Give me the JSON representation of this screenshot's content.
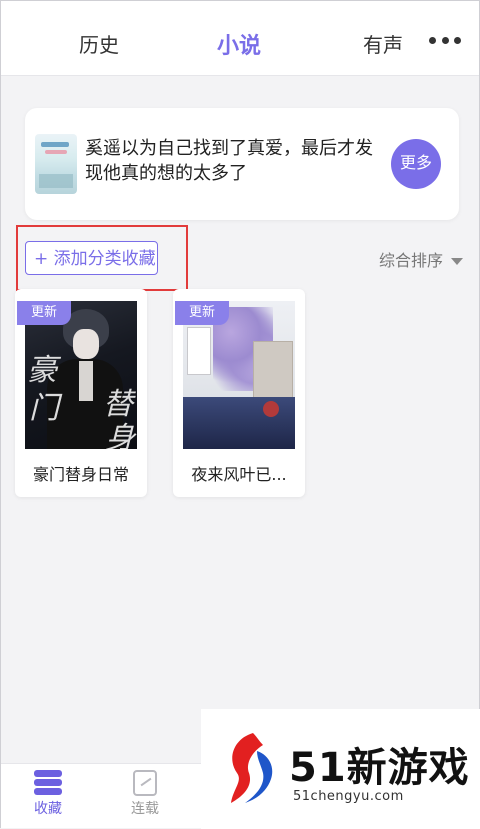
{
  "top_tabs": [
    {
      "label": "历史"
    },
    {
      "label": "小说"
    },
    {
      "label": "有声"
    }
  ],
  "active_tab_index": 1,
  "colors": {
    "accent": "#7a6ee8",
    "highlight_box": "#e23b3b"
  },
  "recommendation": {
    "text": "奚遥以为自己找到了真爱，最后才发现他真的想的太多了",
    "more_label": "更多"
  },
  "shelf": {
    "add_category_label": "+ 添加分类收藏",
    "sort_label": "综合排序"
  },
  "books": [
    {
      "badge": "更新",
      "title": "豪门替身日常",
      "cover_text": [
        "豪",
        "门",
        "替",
        "身"
      ]
    },
    {
      "badge": "更新",
      "title": "夜来风叶已..."
    }
  ],
  "bottom_nav": [
    {
      "label": "收藏",
      "icon": "bookshelf-icon",
      "active": true
    },
    {
      "label": "连载",
      "icon": "edit-icon",
      "active": false
    }
  ],
  "watermark": {
    "brand": "51新游戏",
    "url": "51chengyu.com"
  }
}
